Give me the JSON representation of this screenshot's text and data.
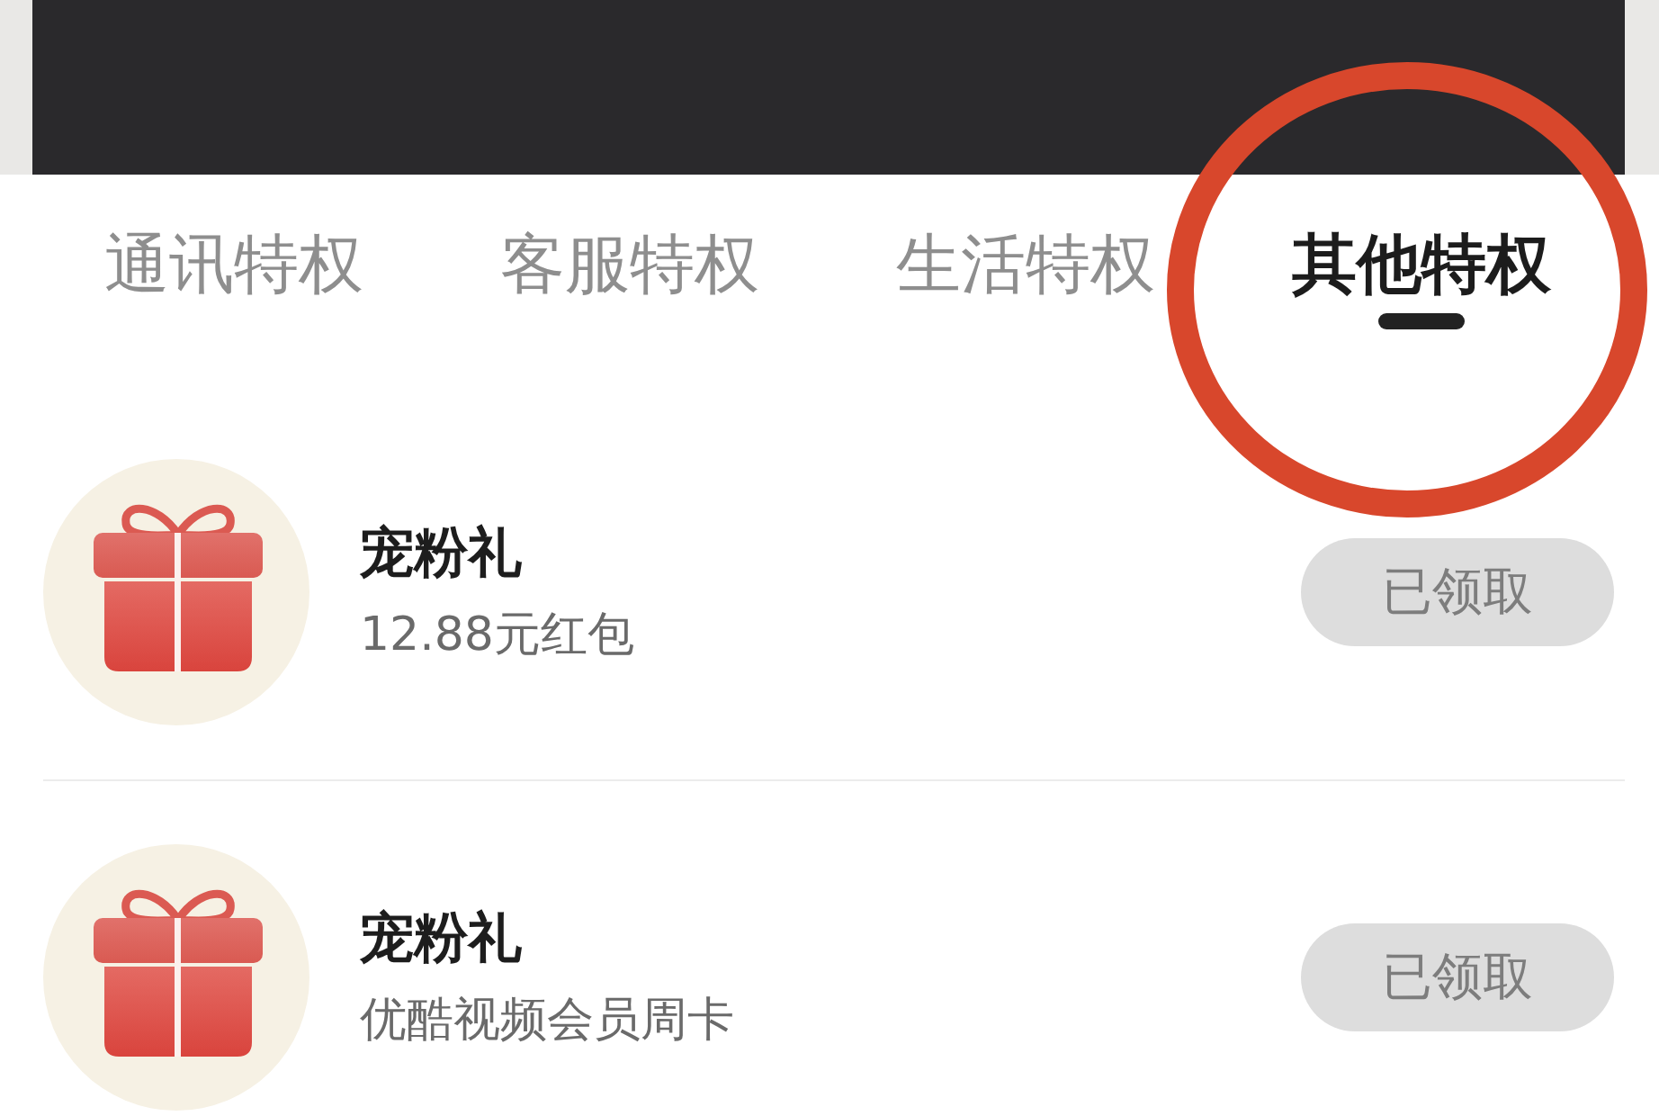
{
  "tabs": [
    {
      "label": "通讯特权",
      "selected": false,
      "circled": false
    },
    {
      "label": "客服特权",
      "selected": false,
      "circled": false
    },
    {
      "label": "生活特权",
      "selected": false,
      "circled": false
    },
    {
      "label": "其他特权",
      "selected": true,
      "circled": true
    }
  ],
  "gifts": [
    {
      "title": "宠粉礼",
      "description": "12.88元红包",
      "button": "已领取",
      "claimed": true
    },
    {
      "title": "宠粉礼",
      "description": "优酷视频会员周卡",
      "button": "已领取",
      "claimed": true
    }
  ]
}
